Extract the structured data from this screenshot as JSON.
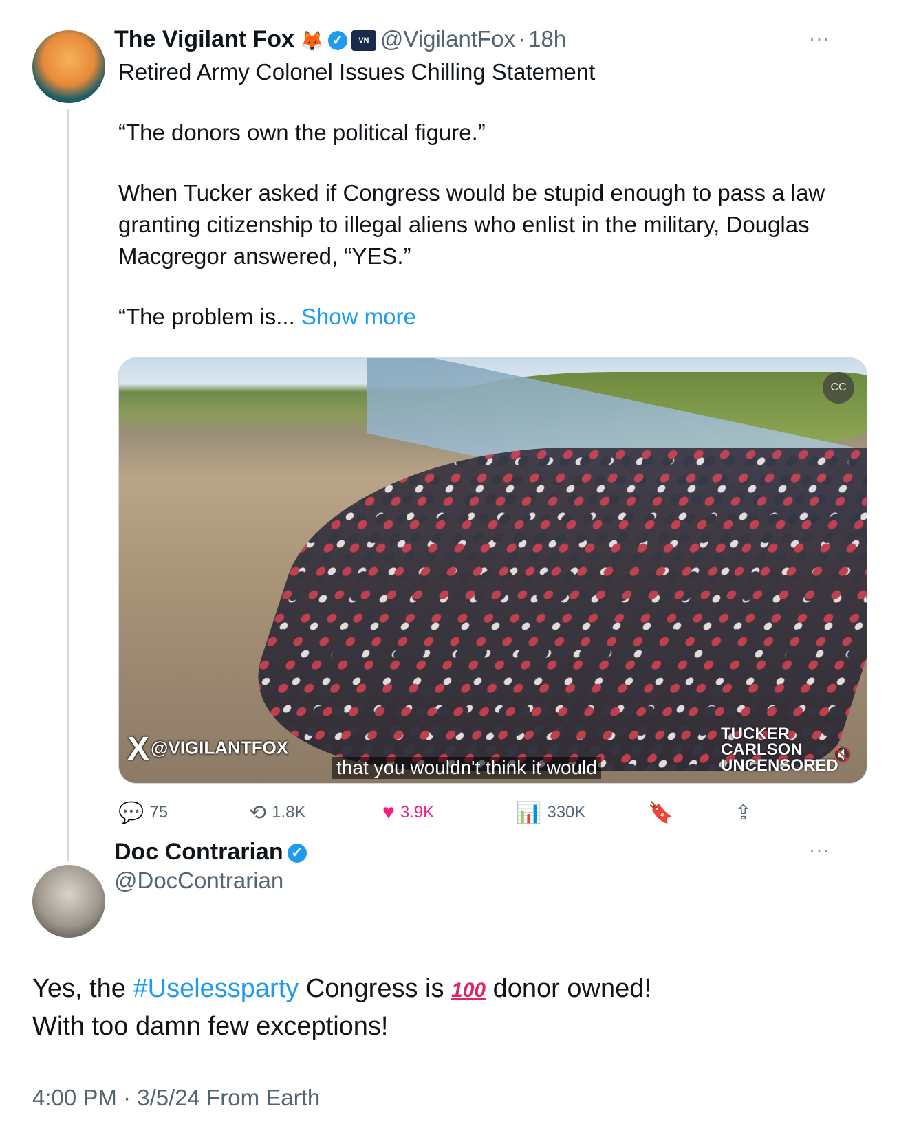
{
  "quoted_tweet": {
    "author_name": "The Vigilant Fox",
    "author_emoji": "🦊",
    "verified_mark": "✓",
    "badge_text": "VN",
    "handle": "@VigilantFox",
    "separator": "·",
    "time": "18h",
    "more": "···",
    "title_line": "Retired Army Colonel Issues Chilling Statement",
    "paragraph_1": "“The donors own the political figure.”",
    "paragraph_2": "When Tucker asked if Congress would be stupid enough to pass a law granting citizenship to illegal aliens who enlist in the military, Douglas Macgregor answered, “YES.”",
    "paragraph_3_start": "“The problem is... ",
    "show_more": "Show more",
    "media": {
      "watermark_left": "@VIGILANTFOX",
      "watermark_x": "X",
      "caption": "that you wouldn't think it would",
      "watermark_right": "TUCKER CARLSON UNCENSORED",
      "cc_label": "CC",
      "mute_icon": "🔇"
    },
    "actions": {
      "replies": "75",
      "reposts": "1.8K",
      "likes": "3.9K",
      "views": "330K",
      "reply_icon": "💬",
      "repost_icon": "⟲",
      "like_icon": "♥",
      "views_icon": "📊",
      "bookmark_icon": "🔖",
      "share_icon": "⇪"
    }
  },
  "reply_tweet": {
    "author_name": "Doc Contrarian",
    "verified_mark": "✓",
    "handle": "@DocContrarian",
    "more": "···",
    "line_1_prefix": "Yes, the ",
    "hashtag": "#Uselessparty",
    "line_1_mid": " Congress is ",
    "hundred_emoji": "100",
    "line_1_suffix": " donor owned!",
    "line_2": "With too damn few exceptions!",
    "timestamp_meta": "4:00 PM · 3/5/24 From Earth"
  },
  "colors": {
    "link": "#1d9bf0",
    "secondary_text": "#536471",
    "like_pink": "#f91880",
    "thread_line": "#cfd9de"
  }
}
